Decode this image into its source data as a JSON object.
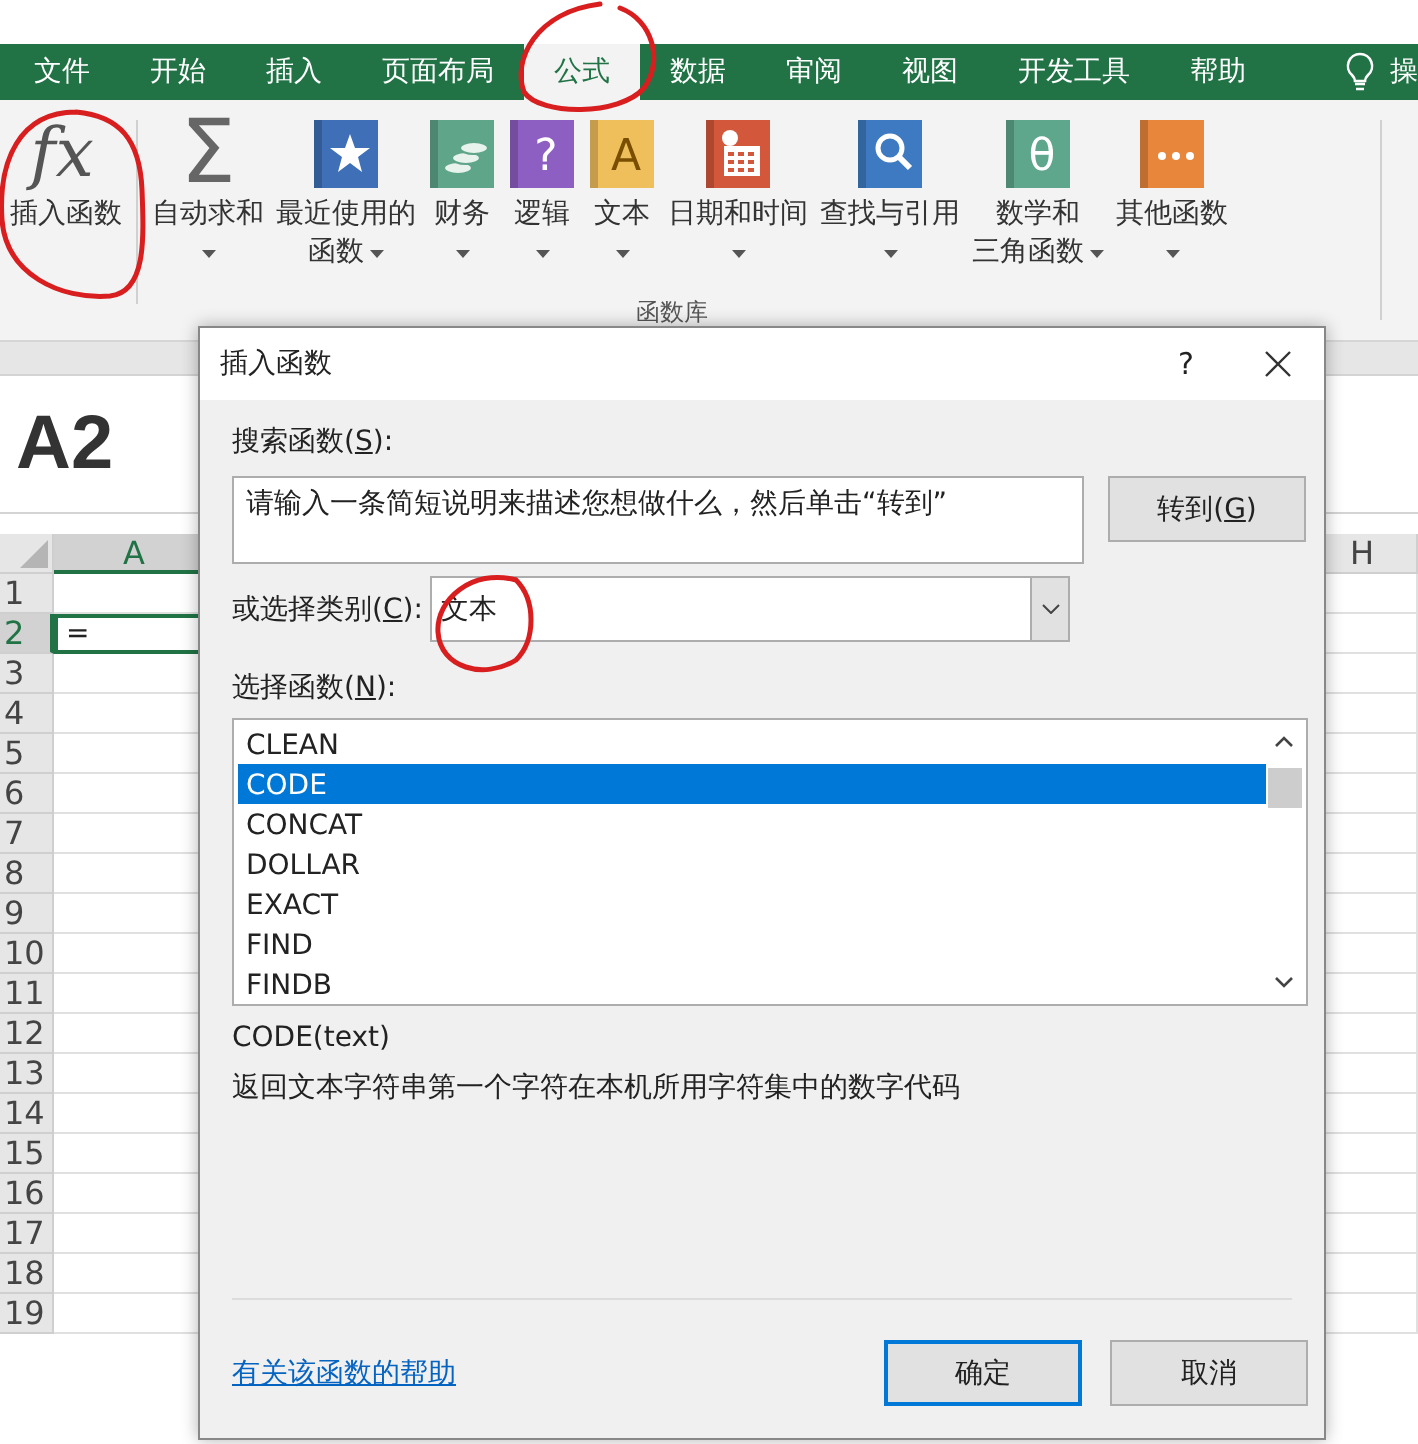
{
  "tabs": [
    {
      "label": "文件",
      "selected": false
    },
    {
      "label": "开始",
      "selected": false
    },
    {
      "label": "插入",
      "selected": false
    },
    {
      "label": "页面布局",
      "selected": false
    },
    {
      "label": "公式",
      "selected": true
    },
    {
      "label": "数据",
      "selected": false
    },
    {
      "label": "审阅",
      "selected": false
    },
    {
      "label": "视图",
      "selected": false
    },
    {
      "label": "开发工具",
      "selected": false
    },
    {
      "label": "帮助",
      "selected": false
    }
  ],
  "tell_me": "操",
  "ribbon": {
    "items": [
      {
        "lines": [
          "插入函数"
        ],
        "dropdown": false,
        "icon": {
          "kind": "text",
          "glyph": "fx"
        }
      },
      {
        "lines": [
          "自动求和"
        ],
        "dropdown": true,
        "icon": {
          "kind": "text",
          "glyph": "Σ"
        }
      },
      {
        "lines": [
          "最近使用的",
          "函数"
        ],
        "dropdown": true,
        "icon": {
          "kind": "star",
          "color": "#3f6fb6"
        }
      },
      {
        "lines": [
          "财务"
        ],
        "dropdown": true,
        "icon": {
          "kind": "coins",
          "color": "#5fa58a"
        }
      },
      {
        "lines": [
          "逻辑"
        ],
        "dropdown": true,
        "icon": {
          "kind": "glyph",
          "glyph": "?",
          "color": "#8e5fc2"
        }
      },
      {
        "lines": [
          "文本"
        ],
        "dropdown": true,
        "icon": {
          "kind": "glyph",
          "glyph": "A",
          "color": "#efbf5c"
        }
      },
      {
        "lines": [
          "日期和时间"
        ],
        "dropdown": true,
        "icon": {
          "kind": "calendar",
          "color": "#d3573b"
        }
      },
      {
        "lines": [
          "查找与引用"
        ],
        "dropdown": true,
        "icon": {
          "kind": "search",
          "color": "#3d7ac1"
        }
      },
      {
        "lines": [
          "数学和",
          "三角函数"
        ],
        "dropdown": true,
        "icon": {
          "kind": "glyph",
          "glyph": "θ",
          "color": "#5ea68c"
        }
      },
      {
        "lines": [
          "其他函数"
        ],
        "dropdown": true,
        "icon": {
          "kind": "dots",
          "color": "#e8873c"
        }
      }
    ],
    "group_label": "函数库"
  },
  "name_box": "A2",
  "sheet": {
    "columns": [
      {
        "label": "A",
        "selected": true
      },
      {
        "label": "H",
        "selected": false
      }
    ],
    "rows": [
      {
        "label": "1",
        "selected": false
      },
      {
        "label": "2",
        "selected": true,
        "value": "="
      },
      {
        "label": "3",
        "selected": false
      },
      {
        "label": "4",
        "selected": false
      },
      {
        "label": "5",
        "selected": false
      },
      {
        "label": "6",
        "selected": false
      },
      {
        "label": "7",
        "selected": false
      },
      {
        "label": "8",
        "selected": false
      },
      {
        "label": "9",
        "selected": false
      },
      {
        "label": "10",
        "selected": false
      },
      {
        "label": "11",
        "selected": false
      },
      {
        "label": "12",
        "selected": false
      },
      {
        "label": "13",
        "selected": false
      },
      {
        "label": "14",
        "selected": false
      },
      {
        "label": "15",
        "selected": false
      },
      {
        "label": "16",
        "selected": false
      },
      {
        "label": "17",
        "selected": false
      },
      {
        "label": "18",
        "selected": false
      },
      {
        "label": "19",
        "selected": false
      }
    ]
  },
  "dialog": {
    "title": "插入函数",
    "help": "?",
    "search_label": {
      "before": "搜索函数(",
      "key": "S",
      "after": "):"
    },
    "search_value": "请输入一条简短说明来描述您想做什么，然后单击“转到”",
    "go_button": {
      "before": "转到(",
      "key": "G",
      "after": ")"
    },
    "category_label": {
      "before": "或选择类别(",
      "key": "C",
      "after": "):"
    },
    "category_value": "文本",
    "functions_label": {
      "before": "选择函数(",
      "key": "N",
      "after": "):"
    },
    "functions": [
      {
        "name": "CLEAN",
        "selected": false
      },
      {
        "name": "CODE",
        "selected": true
      },
      {
        "name": "CONCAT",
        "selected": false
      },
      {
        "name": "DOLLAR",
        "selected": false
      },
      {
        "name": "EXACT",
        "selected": false
      },
      {
        "name": "FIND",
        "selected": false
      },
      {
        "name": "FINDB",
        "selected": false
      }
    ],
    "signature": "CODE(text)",
    "description": "返回文本字符串第一个字符在本机所用字符集中的数字代码",
    "help_link": "有关该函数的帮助",
    "ok_button": "确定",
    "cancel_button": "取消"
  },
  "annotations": [
    {
      "kind": "circle"
    },
    {
      "kind": "circle"
    },
    {
      "kind": "circle"
    }
  ]
}
